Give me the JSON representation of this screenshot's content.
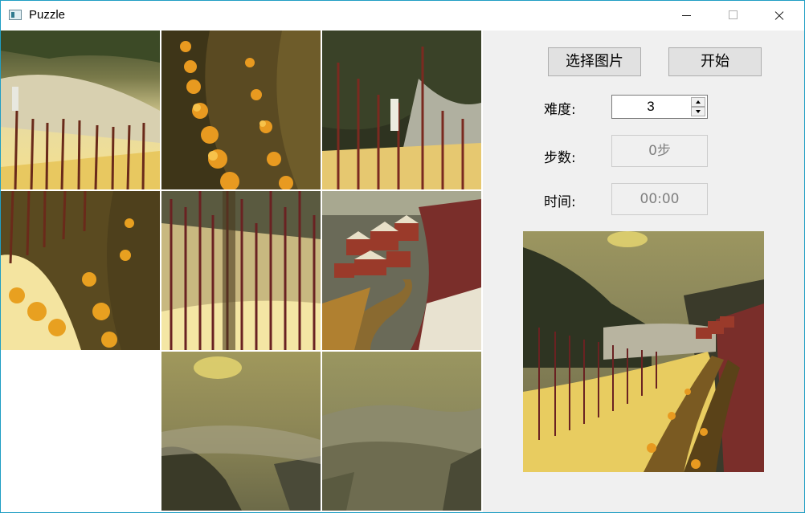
{
  "window": {
    "title": "Puzzle"
  },
  "board": {
    "tiles": [
      {
        "id": 1,
        "scene": "snowy vineyard hillside with fence posts"
      },
      {
        "id": 2,
        "scene": "golden shrubs along a dirt path"
      },
      {
        "id": 3,
        "scene": "fence posts with snowy mountain slope"
      },
      {
        "id": 4,
        "scene": "golden vines along path"
      },
      {
        "id": 5,
        "scene": "dense vine stakes"
      },
      {
        "id": 6,
        "scene": "village houses on winding road"
      },
      {
        "id": 7,
        "scene": "empty slot"
      },
      {
        "id": 8,
        "scene": "misty sky over valley"
      },
      {
        "id": 9,
        "scene": "foggy mountains"
      }
    ]
  },
  "controls": {
    "select_image_label": "选择图片",
    "start_label": "开始",
    "difficulty_label": "难度:",
    "difficulty_value": "3",
    "steps_label": "步数:",
    "steps_value": "0步",
    "time_label": "时间:",
    "time_value": "00:00"
  },
  "colors": {
    "accent_border": "#1f9ec4",
    "panel_bg": "#f0f0f0",
    "button_bg": "#e1e1e1"
  },
  "icons": [
    "app-icon",
    "minimize-icon",
    "maximize-icon",
    "close-icon"
  ]
}
